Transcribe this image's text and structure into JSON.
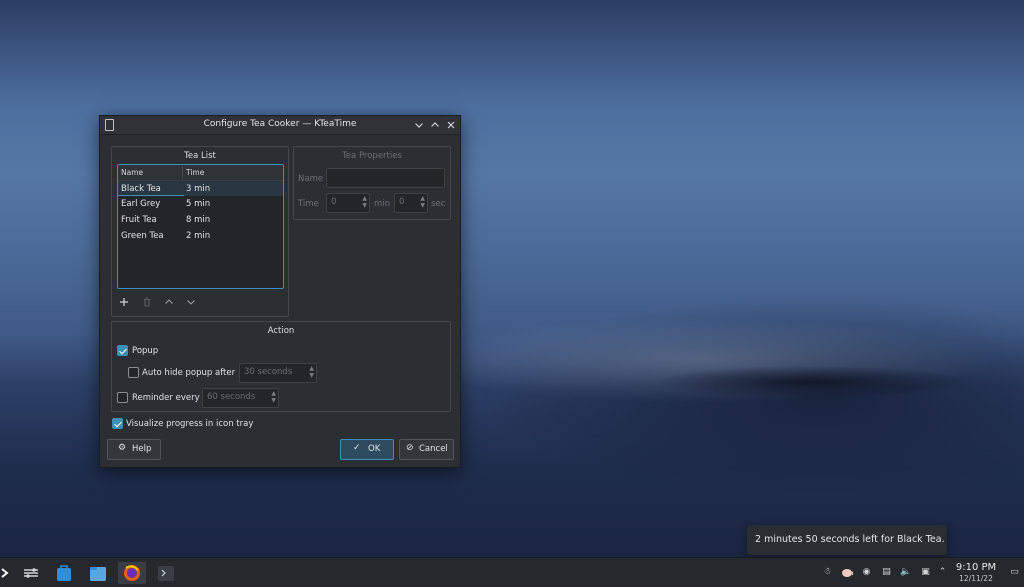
{
  "dialog": {
    "title": "Configure Tea Cooker — KTeaTime",
    "tea_list": {
      "group_title": "Tea List",
      "columns": [
        "Name",
        "Time"
      ],
      "rows": [
        {
          "name": "Black Tea",
          "time": "3 min",
          "selected": true
        },
        {
          "name": "Earl Grey",
          "time": "5 min"
        },
        {
          "name": "Fruit Tea",
          "time": "8 min"
        },
        {
          "name": "Green Tea",
          "time": "2 min"
        }
      ]
    },
    "tea_properties": {
      "group_title": "Tea Properties",
      "name_label": "Name",
      "name_value": "",
      "time_label": "Time",
      "min_value": "0",
      "min_unit": "min",
      "sec_value": "0",
      "sec_unit": "sec"
    },
    "action": {
      "group_title": "Action",
      "popup_label": "Popup",
      "popup_checked": true,
      "auto_hide_label": "Auto hide popup after",
      "auto_hide_checked": false,
      "auto_hide_value": "30 seconds",
      "reminder_label": "Reminder every",
      "reminder_checked": false,
      "reminder_value": "60 seconds"
    },
    "visualize_label": "Visualize progress in icon tray",
    "visualize_checked": true,
    "help_label": "Help",
    "ok_label": "OK",
    "cancel_label": "Cancel"
  },
  "notification": {
    "text": "2 minutes 50 seconds left for Black Tea."
  },
  "taskbar": {
    "time": "9:10 PM",
    "date": "12/11/22"
  },
  "colors": {
    "accent": "#3d8fb6",
    "dialog_bg": "#2b2e33",
    "taskbar_bg": "#25282c"
  }
}
